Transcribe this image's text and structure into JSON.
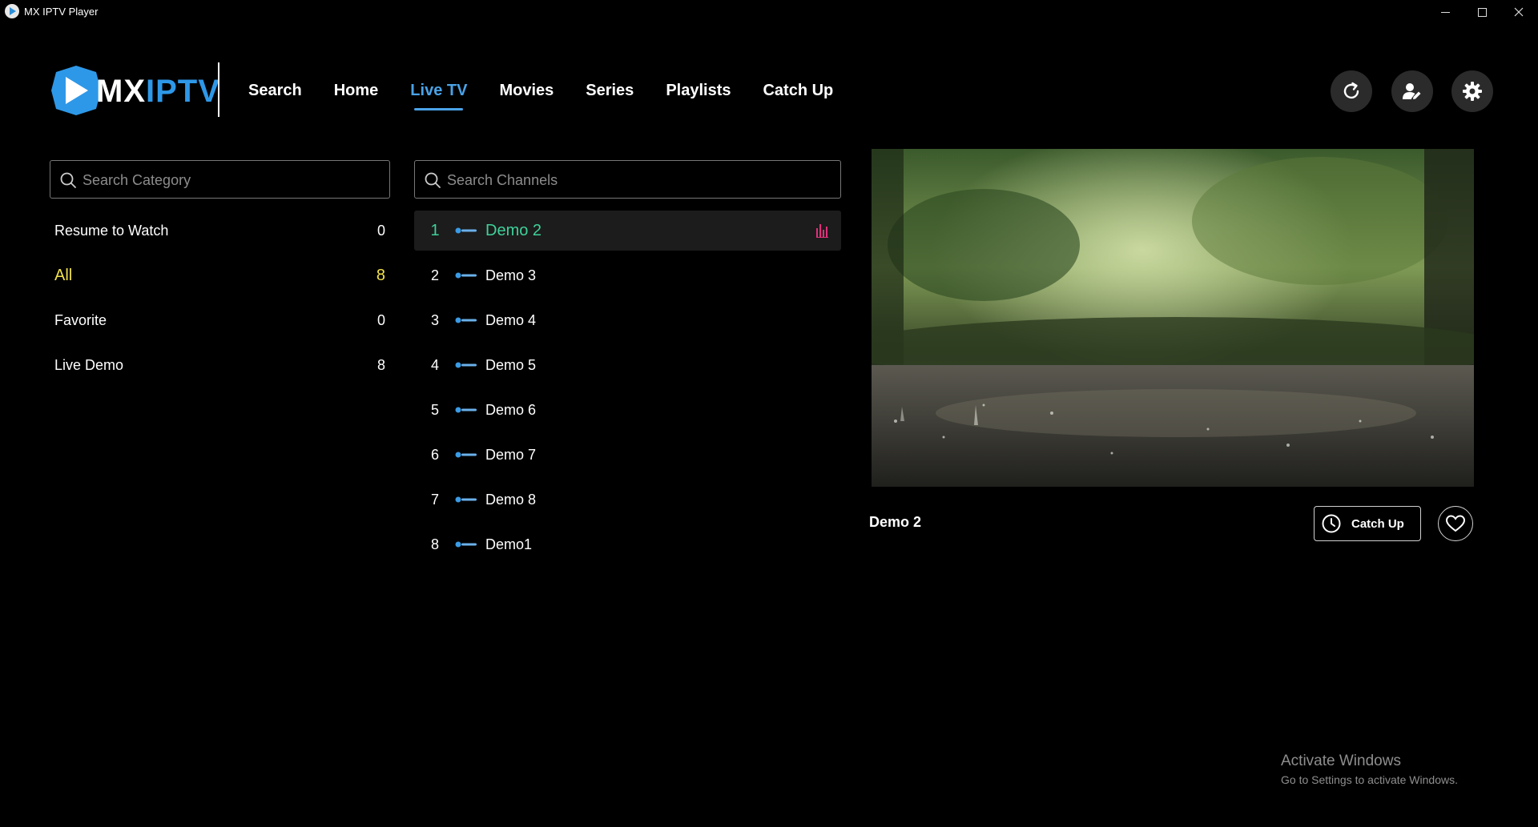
{
  "window": {
    "title": "MX IPTV Player"
  },
  "logo": {
    "part1": "MX",
    "part2": "IPTV"
  },
  "nav": {
    "items": [
      {
        "label": "Search"
      },
      {
        "label": "Home"
      },
      {
        "label": "Live TV",
        "active": true
      },
      {
        "label": "Movies"
      },
      {
        "label": "Series"
      },
      {
        "label": "Playlists"
      },
      {
        "label": "Catch Up"
      }
    ]
  },
  "header_buttons": {
    "refresh_icon": "refresh-icon",
    "user_icon": "user-edit-icon",
    "settings_icon": "gear-icon"
  },
  "category_search": {
    "placeholder": "Search Category",
    "value": ""
  },
  "channel_search": {
    "placeholder": "Search Channels",
    "value": ""
  },
  "categories": [
    {
      "label": "Resume to Watch",
      "count": "0"
    },
    {
      "label": "All",
      "count": "8",
      "active": true
    },
    {
      "label": "Favorite",
      "count": "0"
    },
    {
      "label": "Live Demo",
      "count": "8"
    }
  ],
  "channels": [
    {
      "num": "1",
      "name": "Demo 2",
      "active": true
    },
    {
      "num": "2",
      "name": "Demo 3"
    },
    {
      "num": "3",
      "name": "Demo 4"
    },
    {
      "num": "4",
      "name": "Demo 5"
    },
    {
      "num": "5",
      "name": "Demo 6"
    },
    {
      "num": "6",
      "name": "Demo 7"
    },
    {
      "num": "7",
      "name": "Demo 8"
    },
    {
      "num": "8",
      "name": "Demo1"
    }
  ],
  "player": {
    "now_playing": "Demo 2",
    "catchup_label": "Catch Up"
  },
  "watermark": {
    "title": "Activate Windows",
    "subtitle": "Go to Settings to activate Windows."
  },
  "colors": {
    "background": "#000000",
    "accent_blue": "#4aa3e8",
    "active_category": "#f2e24a",
    "active_channel": "#3fd19a",
    "equalizer": "#e0307a"
  }
}
